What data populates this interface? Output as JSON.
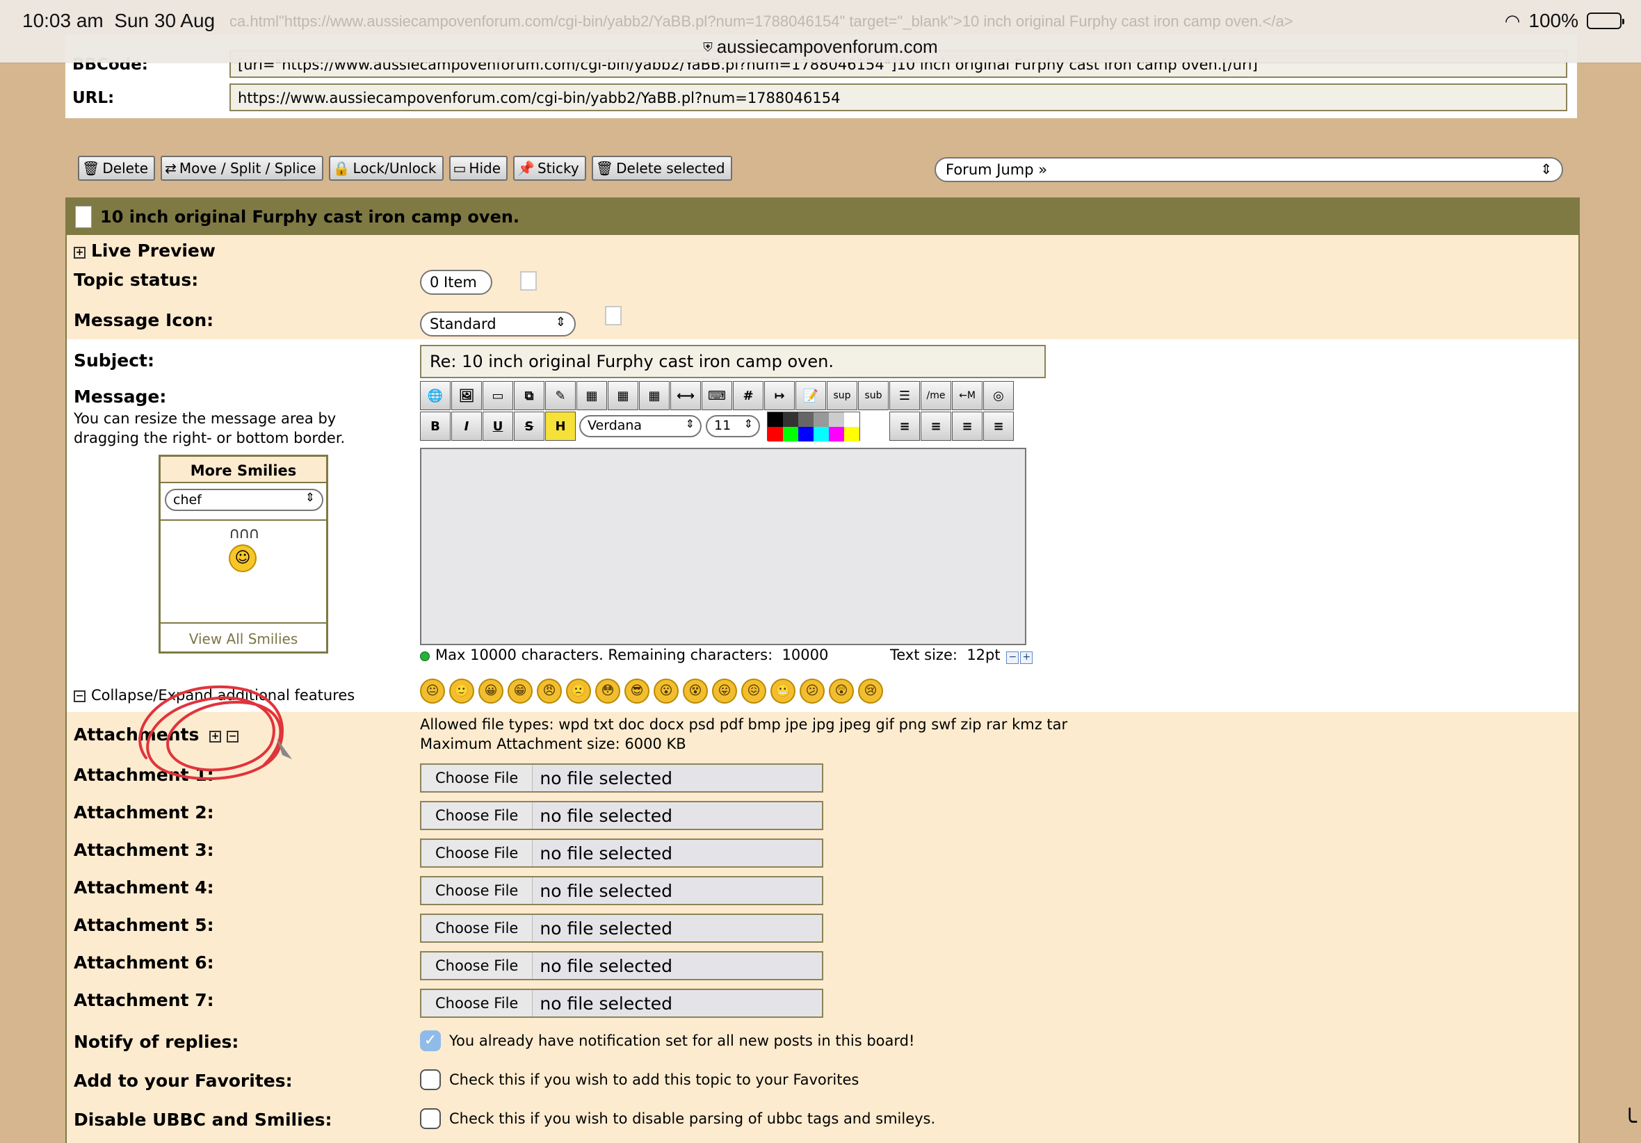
{
  "status_bar": {
    "time": "10:03 am",
    "date": "Sun 30 Aug",
    "battery": "100%",
    "url": "aussiecampovenforum.com"
  },
  "link_box": {
    "ghost_text": "ca.html\"https://www.aussiecampovenforum.com/cgi-bin/yabb2/YaBB.pl?num=1788046154\" target=\"_blank\">10 inch original Furphy cast iron camp oven.</a>",
    "bbcode_label": "BBCode:",
    "bbcode_value": "[url=\"https://www.aussiecampovenforum.com/cgi-bin/yabb2/YaBB.pl?num=1788046154\"]10 inch original Furphy cast iron camp oven.[/url]",
    "url_label": "URL:",
    "url_value": "https://www.aussiecampovenforum.com/cgi-bin/yabb2/YaBB.pl?num=1788046154"
  },
  "mod_buttons": [
    "Delete",
    "Move / Split / Splice",
    "Lock/Unlock",
    "Hide",
    "Sticky",
    "Delete selected"
  ],
  "forum_jump": "Forum Jump »",
  "topic_title": "10 inch original Furphy cast iron camp oven.",
  "live_preview": "Live Preview",
  "topic_status": {
    "label": "Topic status:",
    "value": "0 Item"
  },
  "message_icon": {
    "label": "Message Icon:",
    "value": "Standard"
  },
  "subject": {
    "label": "Subject:",
    "value": "Re: 10 inch original Furphy cast iron camp oven."
  },
  "message": {
    "label": "Message:",
    "hint": "You can resize the message area by dragging the right- or bottom border."
  },
  "smilies_box": {
    "title": "More Smilies",
    "selected": "chef",
    "view_all": "View All Smilies"
  },
  "editor": {
    "toolbar_row1": [
      "🌐",
      "🖼",
      "▭",
      "⧉",
      "✎",
      "▦",
      "▦",
      "▦",
      "⟷",
      "⌨",
      "#",
      "↦",
      "📝",
      "sup",
      "sub",
      "☰",
      "/me",
      "←M",
      "◎"
    ],
    "bold": "B",
    "italic": "I",
    "underline": "U",
    "strike": "S",
    "highlight": "H",
    "font": "Verdana",
    "font_size": "11",
    "colors": [
      "#000000",
      "#333333",
      "#666666",
      "#999999",
      "#cccccc",
      "#ffffff",
      "#ff0000",
      "#00ff00",
      "#0000ff",
      "#00ffff",
      "#ff00ff",
      "#ffff00"
    ],
    "align_icons": [
      "≡",
      "≡",
      "≡",
      "≡"
    ]
  },
  "counter": {
    "text": "Max 10000 characters. Remaining characters:",
    "remaining": "10000",
    "text_size_label": "Text size:",
    "text_size_value": "12",
    "text_size_unit": "pt"
  },
  "smilies": [
    "😐",
    "🙂",
    "😀",
    "😁",
    "😠",
    "🙁",
    "😳",
    "😎",
    "😮",
    "😵",
    "😛",
    "😖",
    "😬",
    "😕",
    "😲",
    "😢"
  ],
  "collapse_label": "Collapse/Expand additional features",
  "attachments": {
    "label": "Attachments",
    "allowed": "Allowed file types: wpd txt doc docx psd pdf bmp jpe jpg jpeg gif png swf zip rar kmz tar",
    "max_size": "Maximum Attachment size: 6000 KB",
    "rows": [
      {
        "label": "Attachment 1:",
        "button": "Choose File",
        "value": "no file selected"
      },
      {
        "label": "Attachment 2:",
        "button": "Choose File",
        "value": "no file selected"
      },
      {
        "label": "Attachment 3:",
        "button": "Choose File",
        "value": "no file selected"
      },
      {
        "label": "Attachment 4:",
        "button": "Choose File",
        "value": "no file selected"
      },
      {
        "label": "Attachment 5:",
        "button": "Choose File",
        "value": "no file selected"
      },
      {
        "label": "Attachment 6:",
        "button": "Choose File",
        "value": "no file selected"
      },
      {
        "label": "Attachment 7:",
        "button": "Choose File",
        "value": "no file selected"
      }
    ]
  },
  "options": [
    {
      "label": "Notify of replies:",
      "checked": true,
      "text": "You already have notification set for all new posts in this board!"
    },
    {
      "label": "Add to your Favorites:",
      "checked": false,
      "text": "Check this if you wish to add this topic to your Favorites"
    },
    {
      "label": "Disable UBBC and Smilies:",
      "checked": false,
      "text": "Check this if you wish to disable parsing of ubbc tags and smileys."
    }
  ]
}
